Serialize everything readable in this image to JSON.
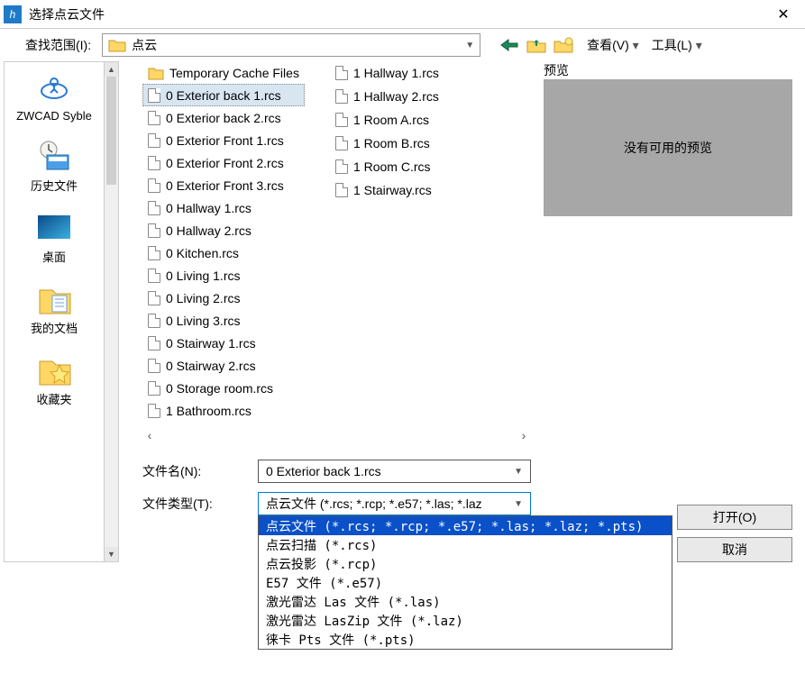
{
  "title": "选择点云文件",
  "toolbar": {
    "scope_label": "查找范围(I):",
    "path_value": "点云",
    "view_label": "查看(V)",
    "tools_label": "工具(L)"
  },
  "places": [
    {
      "label": "ZWCAD Syble",
      "icon": "cloud-app"
    },
    {
      "label": "历史文件",
      "icon": "history"
    },
    {
      "label": "桌面",
      "icon": "desktop"
    },
    {
      "label": "我的文档",
      "icon": "documents"
    },
    {
      "label": "收藏夹",
      "icon": "favorites"
    }
  ],
  "files_col1": [
    "Temporary Cache Files",
    "0 Exterior back 1.rcs",
    "0 Exterior back 2.rcs",
    "0 Exterior Front 1.rcs",
    "0 Exterior Front 2.rcs",
    "0 Exterior Front 3.rcs",
    "0 Hallway 1.rcs",
    "0 Hallway 2.rcs",
    "0 Kitchen.rcs",
    "0 Living 1.rcs",
    "0 Living 2.rcs",
    "0 Living 3.rcs",
    "0 Stairway 1.rcs",
    "0 Stairway 2.rcs",
    "0 Storage room.rcs",
    "1 Bathroom.rcs"
  ],
  "files_col2": [
    "1 Hallway 1.rcs",
    "1 Hallway 2.rcs",
    "1 Room A.rcs",
    "1 Room B.rcs",
    "1 Room C.rcs",
    "1 Stairway.rcs"
  ],
  "selected_index": 1,
  "form": {
    "filename_label": "文件名(N):",
    "filename_value": "0 Exterior back 1.rcs",
    "filetype_label": "文件类型(T):",
    "filetype_value": "点云文件 (*.rcs; *.rcp; *.e57; *.las; *.laz"
  },
  "filetype_options": [
    "点云文件 (*.rcs; *.rcp; *.e57; *.las; *.laz; *.pts)",
    "点云扫描 (*.rcs)",
    "点云投影 (*.rcp)",
    "E57 文件 (*.e57)",
    "激光雷达 Las 文件 (*.las)",
    "激光雷达 LasZip 文件 (*.laz)",
    "徕卡 Pts 文件 (*.pts)"
  ],
  "preview": {
    "label": "预览",
    "empty_text": "没有可用的预览"
  },
  "buttons": {
    "open": "打开(O)",
    "cancel": "取消"
  }
}
